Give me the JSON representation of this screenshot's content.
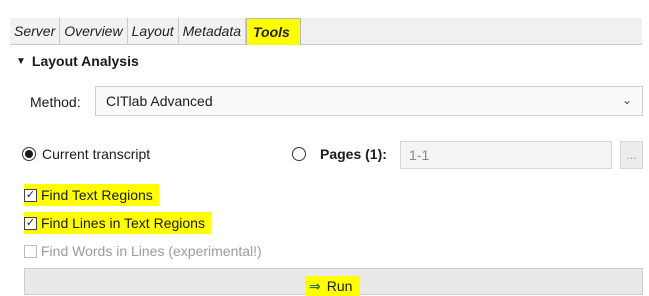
{
  "tabs": [
    {
      "label": "Server"
    },
    {
      "label": "Overview"
    },
    {
      "label": "Layout"
    },
    {
      "label": "Metadata"
    },
    {
      "label": "Tools"
    }
  ],
  "active_tab": "Tools",
  "section": {
    "title": "Layout Analysis",
    "caret": "▼"
  },
  "method": {
    "label": "Method:",
    "value": "CITlab Advanced",
    "chevron": "⌄"
  },
  "scope": {
    "current_transcript": {
      "label": "Current transcript",
      "selected": true
    },
    "pages": {
      "label": "Pages (1):",
      "value": "1-1",
      "selected": false
    },
    "browse_label": "..."
  },
  "options": [
    {
      "label": "Find Text Regions",
      "checked": true,
      "enabled": true
    },
    {
      "label": "Find Lines in Text Regions",
      "checked": true,
      "enabled": true
    },
    {
      "label": "Find Words in Lines (experimental!)",
      "checked": false,
      "enabled": false
    }
  ],
  "run": {
    "label": "Run",
    "icon": "⇒"
  },
  "colors": {
    "highlight": "#ffff00",
    "arrow": "#2e7d32"
  }
}
